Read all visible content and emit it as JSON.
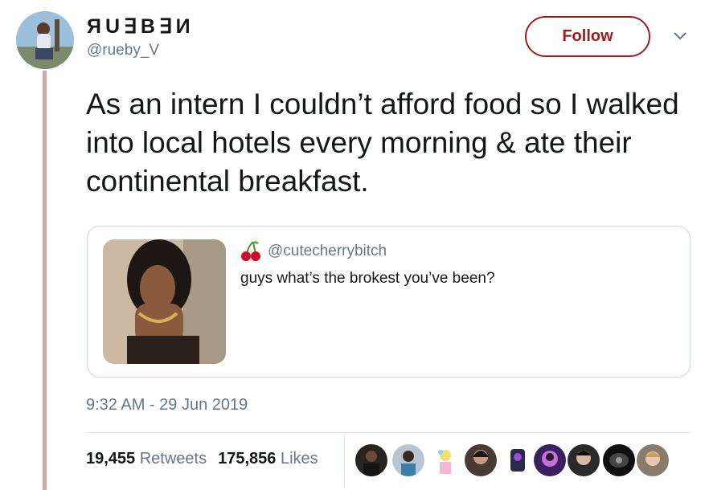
{
  "user": {
    "display_name": "ЯU∃B∃И",
    "handle": "@rueby_V"
  },
  "follow_label": "Follow",
  "tweet": {
    "text": "As an intern I couldn’t afford food so I walked into local hotels every morning & ate their continental breakfast."
  },
  "quoted": {
    "handle": "@cutecherrybitch",
    "text": "guys what’s the brokest you’ve been?"
  },
  "timestamp": "9:32 AM - 29 Jun 2019",
  "stats": {
    "retweets_count": "19,455",
    "retweets_label": "Retweets",
    "likes_count": "175,856",
    "likes_label": "Likes"
  },
  "colors": {
    "accent": "#9c1c20",
    "thread_line": "#d6a4a4",
    "secondary_text": "#657786",
    "border": "#ccd6dd"
  }
}
